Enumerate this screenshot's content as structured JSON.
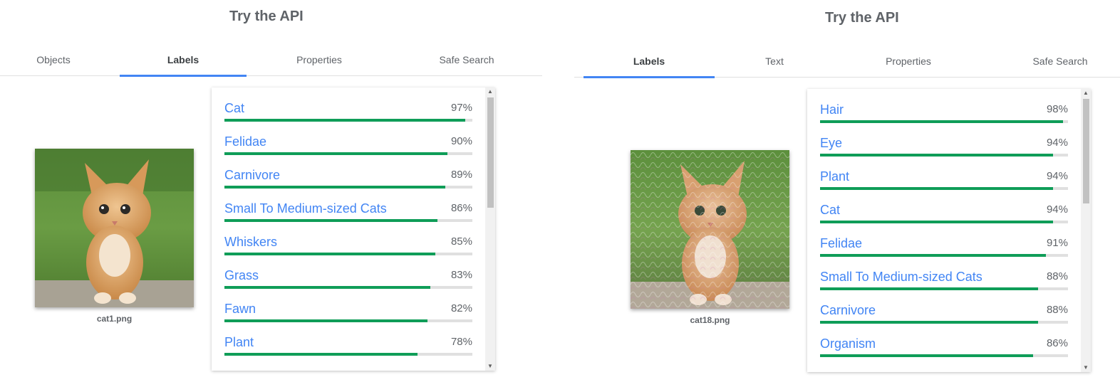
{
  "left_panel": {
    "title": "Try the API",
    "tabs": [
      {
        "label": "Objects"
      },
      {
        "label": "Labels"
      },
      {
        "label": "Properties"
      },
      {
        "label": "Safe Search"
      }
    ],
    "active_tab": "Labels",
    "image_caption": "cat1.png",
    "labels": [
      {
        "name": "Cat",
        "score": 0.97,
        "pct": "97%"
      },
      {
        "name": "Felidae",
        "score": 0.9,
        "pct": "90%"
      },
      {
        "name": "Carnivore",
        "score": 0.89,
        "pct": "89%"
      },
      {
        "name": "Small To Medium-sized Cats",
        "score": 0.86,
        "pct": "86%"
      },
      {
        "name": "Whiskers",
        "score": 0.85,
        "pct": "85%"
      },
      {
        "name": "Grass",
        "score": 0.83,
        "pct": "83%"
      },
      {
        "name": "Fawn",
        "score": 0.82,
        "pct": "82%"
      },
      {
        "name": "Plant",
        "score": 0.78,
        "pct": "78%"
      }
    ]
  },
  "right_panel": {
    "title": "Try the API",
    "tabs": [
      {
        "label": "Labels"
      },
      {
        "label": "Text"
      },
      {
        "label": "Properties"
      },
      {
        "label": "Safe Search"
      }
    ],
    "active_tab": "Labels",
    "image_caption": "cat18.png",
    "labels": [
      {
        "name": "Hair",
        "score": 0.98,
        "pct": "98%"
      },
      {
        "name": "Eye",
        "score": 0.94,
        "pct": "94%"
      },
      {
        "name": "Plant",
        "score": 0.94,
        "pct": "94%"
      },
      {
        "name": "Cat",
        "score": 0.94,
        "pct": "94%"
      },
      {
        "name": "Felidae",
        "score": 0.91,
        "pct": "91%"
      },
      {
        "name": "Small To Medium-sized Cats",
        "score": 0.88,
        "pct": "88%"
      },
      {
        "name": "Carnivore",
        "score": 0.88,
        "pct": "88%"
      },
      {
        "name": "Organism",
        "score": 0.86,
        "pct": "86%"
      }
    ]
  },
  "colors": {
    "accent": "#4285f4",
    "bar_fill": "#0f9d58",
    "bar_track": "#e0e0e0"
  },
  "icons": {
    "scroll_up": "scroll-up-arrow-icon",
    "scroll_down": "scroll-down-arrow-icon"
  }
}
